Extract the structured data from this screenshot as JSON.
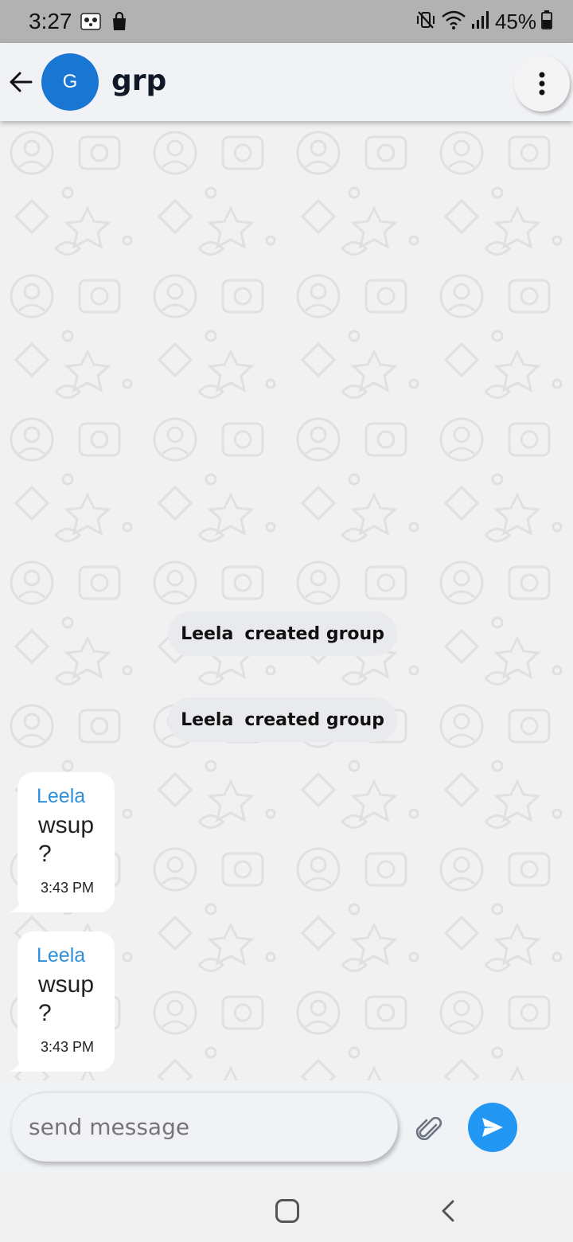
{
  "status_bar": {
    "time": "3:27",
    "battery": "45%",
    "icons": [
      "panda-notification-icon",
      "shopping-bag-icon",
      "vibrate-mute-icon",
      "wifi-icon",
      "signal-icon",
      "battery-icon"
    ]
  },
  "header": {
    "avatar_initial": "G",
    "title": "grp",
    "avatar_color": "#1976d2",
    "icons": [
      "back-arrow-icon",
      "more-vert-icon"
    ]
  },
  "chat": {
    "system_messages": [
      {
        "sender": "Leela",
        "text": "created group"
      },
      {
        "sender": "Leela",
        "text": "created group"
      }
    ],
    "messages": [
      {
        "sender": "Leela",
        "text": "wsup ?",
        "time": "3:43 PM"
      },
      {
        "sender": "Leela",
        "text": "wsup ?",
        "time": "3:43 PM"
      }
    ],
    "sender_color": "#2f8fd8"
  },
  "composer": {
    "placeholder": "send message",
    "send_color": "#2196f3",
    "icons": [
      "paperclip-icon",
      "send-icon"
    ]
  },
  "nav_bar": {
    "icons": [
      "home-icon",
      "back-icon"
    ]
  }
}
